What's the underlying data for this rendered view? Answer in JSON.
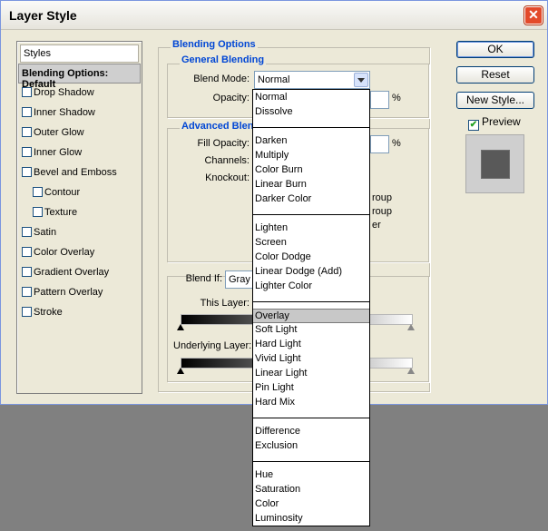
{
  "window": {
    "title": "Layer Style"
  },
  "styles_panel": {
    "header": "Styles",
    "selected": "Blending Options: Default",
    "items": [
      "Drop Shadow",
      "Inner Shadow",
      "Outer Glow",
      "Inner Glow",
      "Bevel and Emboss",
      "Contour",
      "Texture",
      "Satin",
      "Color Overlay",
      "Gradient Overlay",
      "Pattern Overlay",
      "Stroke"
    ]
  },
  "blending": {
    "section_title": "Blending Options",
    "general_title": "General Blending",
    "blend_mode_label": "Blend Mode:",
    "blend_mode_value": "Normal",
    "opacity_label": "Opacity:",
    "percent": "%",
    "advanced_title": "Advanced Blend",
    "fill_opacity_label": "Fill Opacity:",
    "channels_label": "Channels:",
    "knockout_label": "Knockout:",
    "partial_1": "roup",
    "partial_2": "roup",
    "partial_3": "er",
    "blend_if_label": "Blend If:",
    "blend_if_value": "Gray",
    "this_layer_label": "This Layer:",
    "underlying_layer_label": "Underlying Layer:"
  },
  "buttons": {
    "ok": "OK",
    "reset": "Reset",
    "new_style": "New Style..."
  },
  "preview": {
    "label": "Preview",
    "checked": true
  },
  "dropdown": {
    "groups": [
      [
        "Normal",
        "Dissolve"
      ],
      [
        "Darken",
        "Multiply",
        "Color Burn",
        "Linear Burn",
        "Darker Color"
      ],
      [
        "Lighten",
        "Screen",
        "Color Dodge",
        "Linear Dodge (Add)",
        "Lighter Color"
      ],
      [
        "Overlay",
        "Soft Light",
        "Hard Light",
        "Vivid Light",
        "Linear Light",
        "Pin Light",
        "Hard Mix"
      ],
      [
        "Difference",
        "Exclusion"
      ],
      [
        "Hue",
        "Saturation",
        "Color",
        "Luminosity"
      ]
    ],
    "highlighted": "Overlay"
  }
}
